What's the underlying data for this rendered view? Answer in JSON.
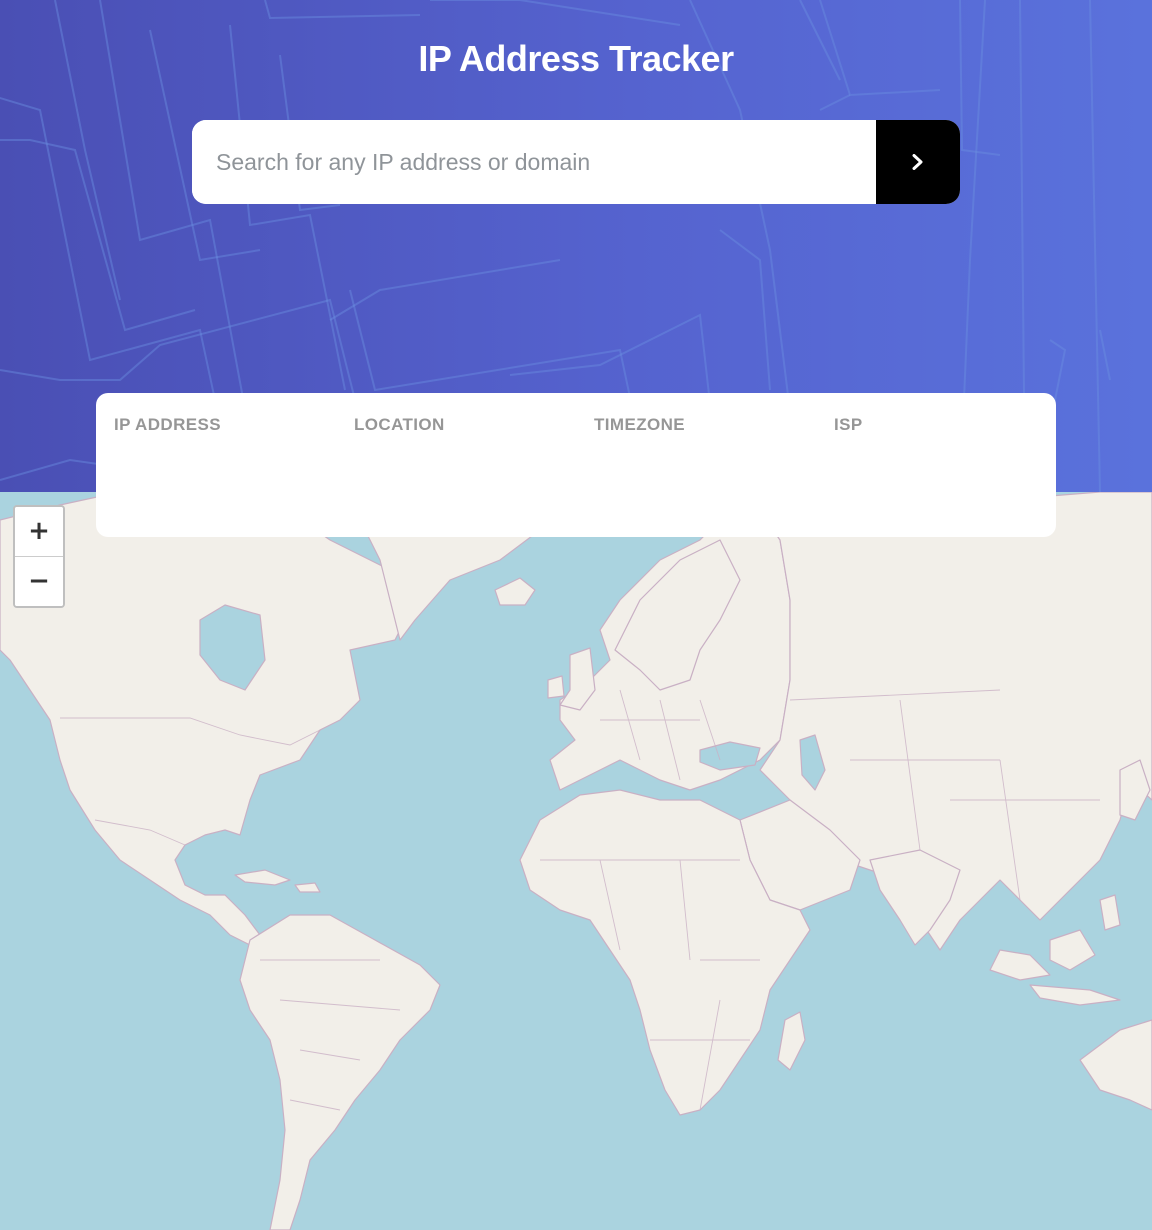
{
  "app": {
    "title": "IP Address Tracker"
  },
  "search": {
    "placeholder": "Search for any IP address or domain",
    "value": "",
    "submit_icon": "chevron-right-icon"
  },
  "info": {
    "ip_address": {
      "label": "IP ADDRESS",
      "value": ""
    },
    "location": {
      "label": "LOCATION",
      "value": ""
    },
    "timezone": {
      "label": "TIMEZONE",
      "value": ""
    },
    "isp": {
      "label": "ISP",
      "value": ""
    }
  },
  "map": {
    "zoom_in_label": "+",
    "zoom_out_label": "−"
  },
  "colors": {
    "header_gradient_start": "#4a4fb4",
    "header_gradient_end": "#5a72dc",
    "ocean": "#aad3df",
    "land": "#f2efe9",
    "border": "#c9b0c4",
    "button": "#000000",
    "label": "#969696"
  }
}
